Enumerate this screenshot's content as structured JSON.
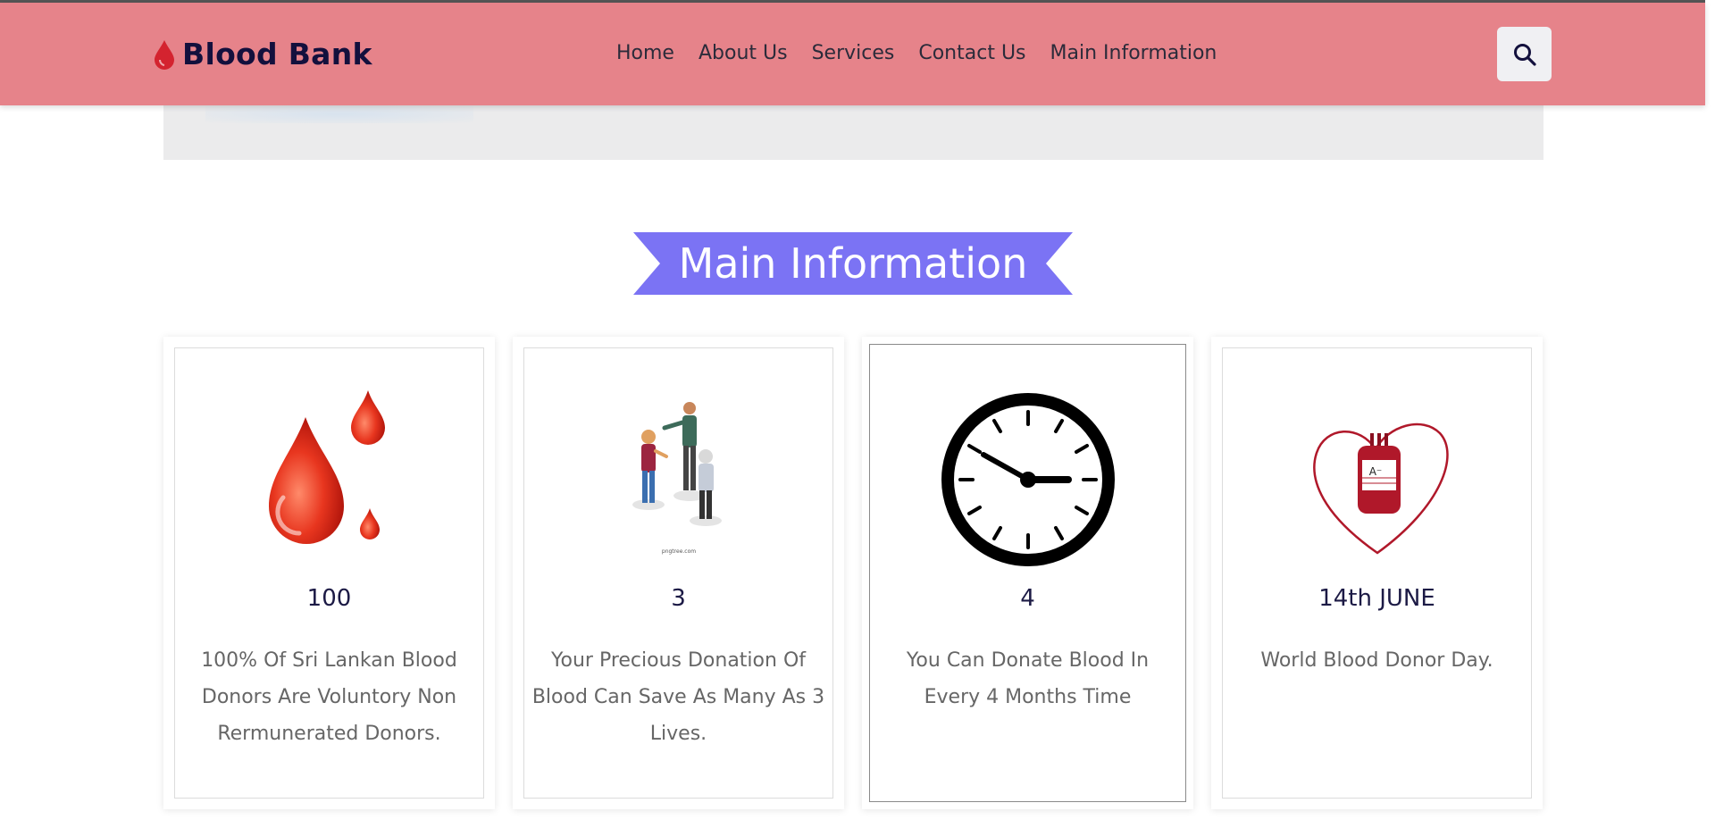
{
  "header": {
    "logo_text": "Blood Bank",
    "logo_icon": "blood-drop-icon",
    "nav": [
      {
        "label": "Home"
      },
      {
        "label": "About Us"
      },
      {
        "label": "Services"
      },
      {
        "label": "Contact Us"
      },
      {
        "label": "Main Information"
      }
    ],
    "search_icon": "search-icon"
  },
  "section": {
    "title": "Main Information"
  },
  "cards": [
    {
      "icon": "blood-drops-icon",
      "number": "100",
      "description": "100% Of Sri Lankan Blood Donors Are Voluntory Non Rermunerated Donors."
    },
    {
      "icon": "people-group-icon",
      "number": "3",
      "description": "Your Precious Donation Of Blood Can Save As Many As 3 Lives.",
      "icon_caption": "pngtree.com"
    },
    {
      "icon": "clock-icon",
      "number": "4",
      "description": "You Can Donate Blood In Every 4 Months Time"
    },
    {
      "icon": "blood-bag-heart-icon",
      "number": "14th JUNE",
      "description": "World Blood Donor Day.",
      "bag_label": "A⁻"
    }
  ],
  "colors": {
    "header_bg": "#e6838a",
    "brand_text": "#13103d",
    "ribbon": "#7b73f4",
    "blood_red": "#e0301e"
  }
}
